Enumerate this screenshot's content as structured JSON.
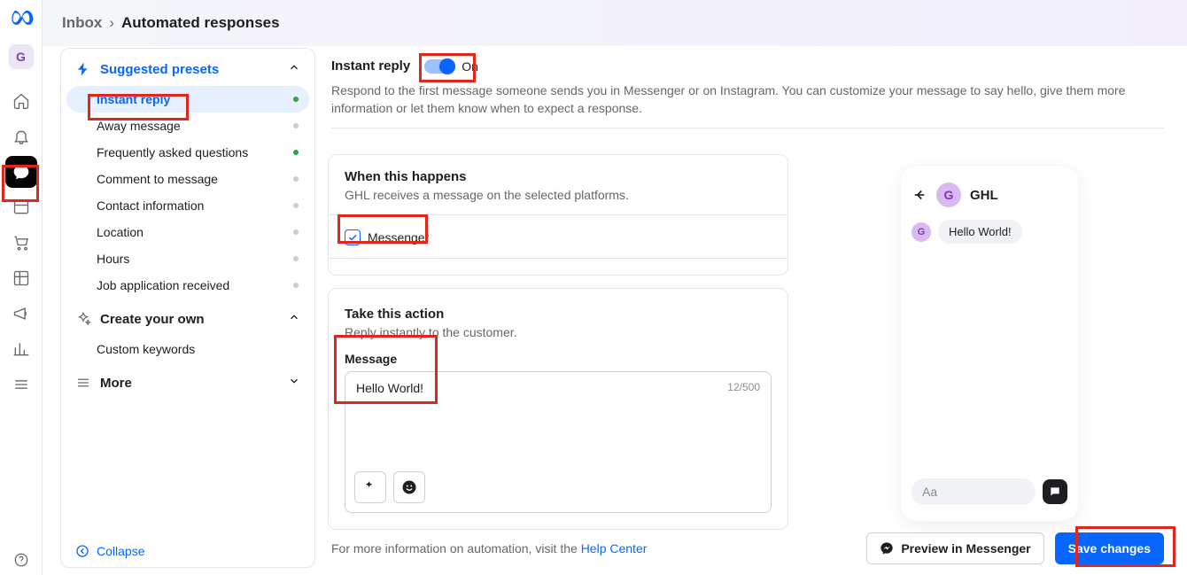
{
  "brand_color": "#0866ff",
  "user_avatar_initial": "G",
  "rail": {
    "items": [
      "home",
      "bell",
      "messages",
      "planner",
      "cart",
      "insights-table",
      "announce",
      "bar-chart",
      "menu"
    ],
    "active_index": 2
  },
  "breadcrumbs": {
    "parent": "Inbox",
    "current": "Automated responses"
  },
  "sidebar": {
    "presets_header": "Suggested presets",
    "items": [
      {
        "label": "Instant reply",
        "status": "on"
      },
      {
        "label": "Away message",
        "status": "off"
      },
      {
        "label": "Frequently asked questions",
        "status": "on"
      },
      {
        "label": "Comment to message",
        "status": "off"
      },
      {
        "label": "Contact information",
        "status": "off"
      },
      {
        "label": "Location",
        "status": "off"
      },
      {
        "label": "Hours",
        "status": "off"
      },
      {
        "label": "Job application received",
        "status": "off"
      }
    ],
    "selected_index": 0,
    "create_header": "Create your own",
    "create_items": [
      {
        "label": "Custom keywords"
      }
    ],
    "more_header": "More",
    "collapse_label": "Collapse"
  },
  "header": {
    "title": "Instant reply",
    "toggle_state": "On",
    "description": "Respond to the first message someone sends you in Messenger or on Instagram. You can customize your message to say hello, give them more information or let them know when to expect a response."
  },
  "when_card": {
    "title": "When this happens",
    "subtitle": "GHL receives a message on the selected platforms.",
    "checkbox_label": "Messenger",
    "checkbox_checked": true
  },
  "action_card": {
    "title": "Take this action",
    "subtitle": "Reply instantly to the customer.",
    "message_label": "Message",
    "message_text": "Hello World!",
    "counter": "12/500"
  },
  "preview": {
    "name": "GHL",
    "avatar_initial": "G",
    "bubble_text": "Hello World!",
    "input_placeholder": "Aa"
  },
  "footer": {
    "info_prefix": "For more information on automation, visit the ",
    "link_label": "Help Center",
    "preview_btn": "Preview in Messenger",
    "save_btn": "Save changes"
  }
}
